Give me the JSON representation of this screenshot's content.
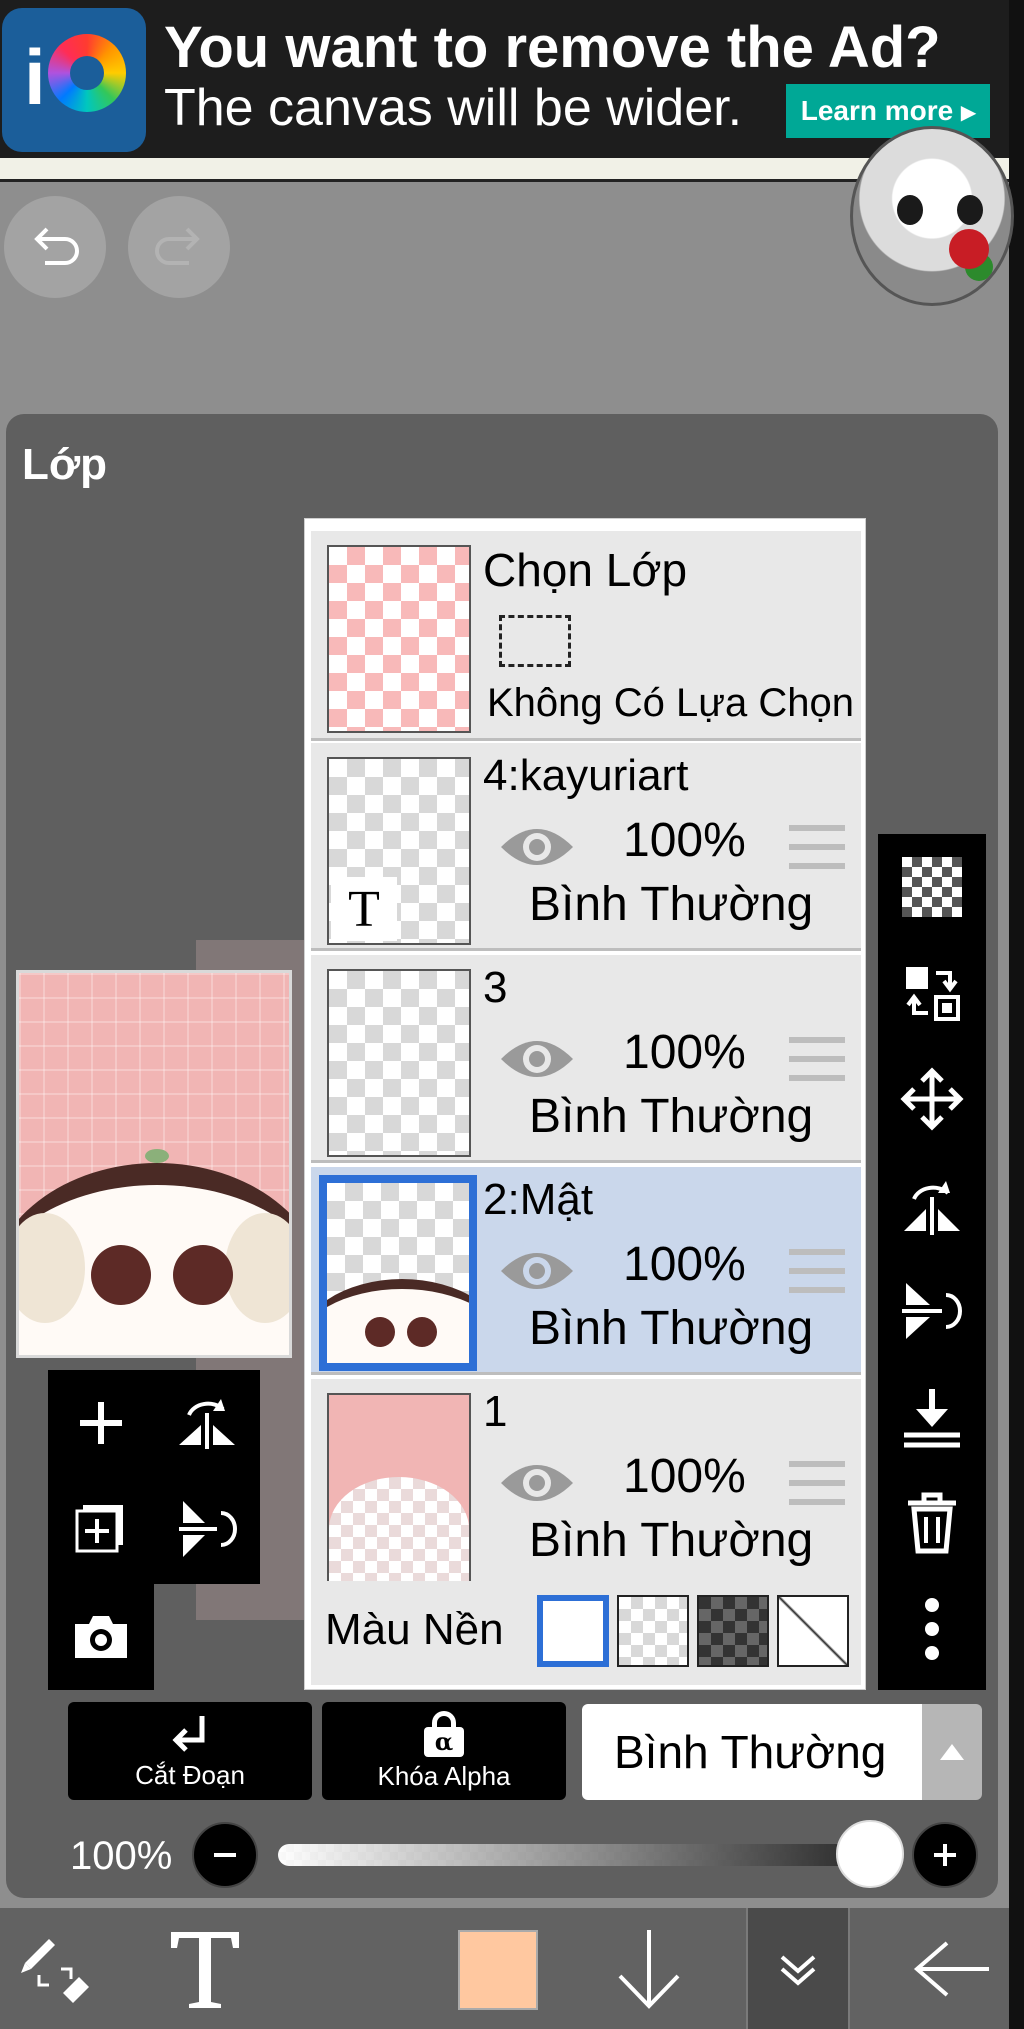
{
  "ad": {
    "title": "You want to remove the Ad?",
    "subtitle": "The canvas will be wider.",
    "cta": "Learn more",
    "cta_arrow": "▸",
    "accent": "#00a896",
    "icon": "ibispaint-logo"
  },
  "toolbar_top": {
    "undo_icon": "undo-icon",
    "redo_icon": "redo-icon"
  },
  "panel": {
    "title": "Lớp"
  },
  "selection_layer": {
    "title": "Chọn Lớp",
    "status": "Không Có Lựa Chọn"
  },
  "layers": [
    {
      "name": "4:kayuriart",
      "opacity": "100%",
      "mode": "Bình Thường",
      "type": "text",
      "selected": false
    },
    {
      "name": "3",
      "opacity": "100%",
      "mode": "Bình Thường",
      "type": "normal",
      "selected": false
    },
    {
      "name": "2:Mật",
      "opacity": "100%",
      "mode": "Bình Thường",
      "type": "normal",
      "selected": true
    },
    {
      "name": "1",
      "opacity": "100%",
      "mode": "Bình Thường",
      "type": "normal",
      "selected": false
    }
  ],
  "background": {
    "label": "Màu Nền",
    "options": [
      "white",
      "transparent",
      "dark-checker",
      "none"
    ],
    "selected": "white"
  },
  "layer_actions": {
    "clipping_label": "Cắt Đoạn",
    "alpha_lock_label": "Khóa Alpha",
    "alpha_symbol": "α",
    "blend_mode": "Bình Thường"
  },
  "opacity": {
    "label": "100%",
    "value": 100
  },
  "colors": {
    "selected_layer_bg": "#cad7eb",
    "selected_border": "#2d6fd6",
    "current_color": "#ffc8a0"
  }
}
